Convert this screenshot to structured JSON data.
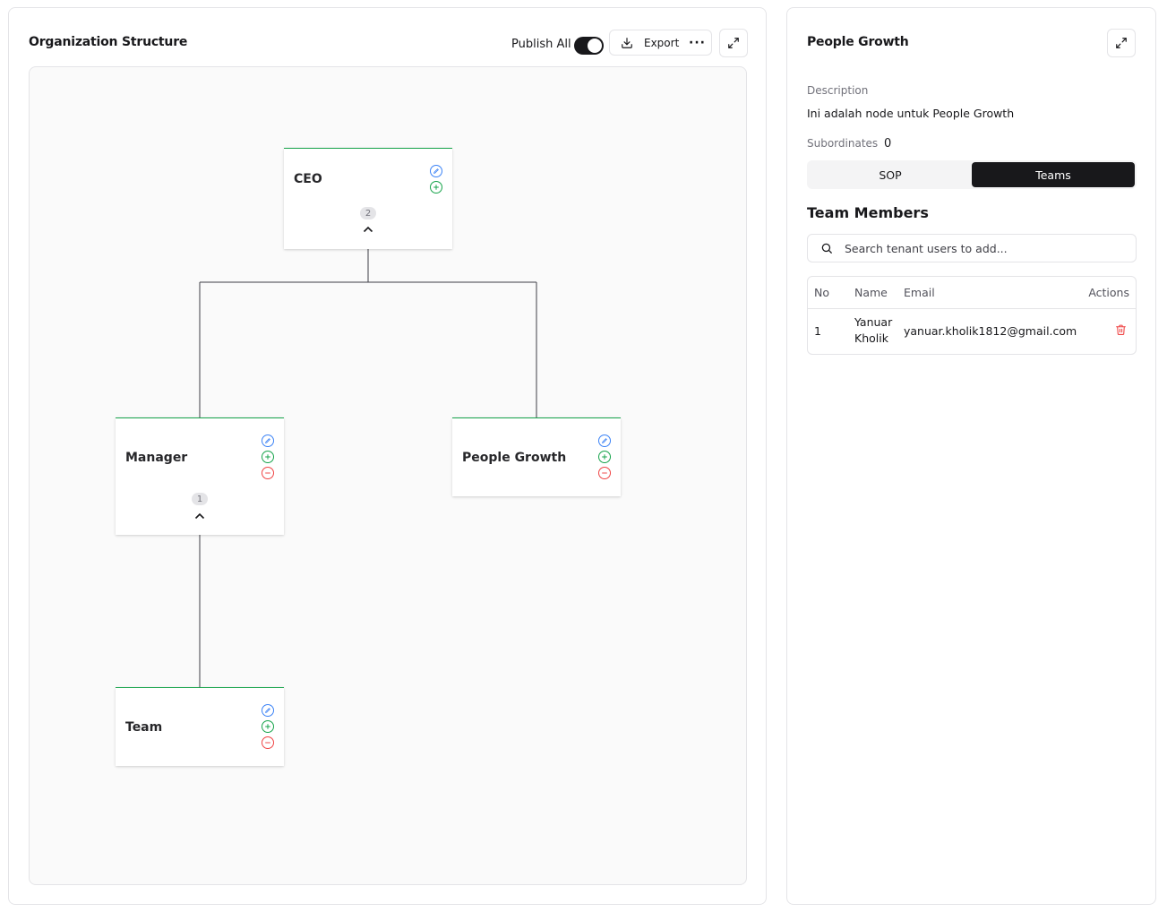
{
  "org_panel": {
    "title": "Organization Structure",
    "publish_label": "Publish All",
    "publish_enabled": true,
    "export_label": "Export",
    "more_label": "···",
    "nodes": {
      "ceo": {
        "title": "CEO",
        "subordinate_count": "2"
      },
      "manager": {
        "title": "Manager",
        "subordinate_count": "1"
      },
      "people_growth": {
        "title": "People Growth"
      },
      "team": {
        "title": "Team"
      }
    }
  },
  "detail_panel": {
    "title": "People Growth",
    "description_label": "Description",
    "description_value": "Ini adalah node untuk People Growth",
    "subordinates_label": "Subordinates",
    "subordinates_value": "0",
    "tabs": [
      {
        "label": "SOP",
        "active": false
      },
      {
        "label": "Teams",
        "active": true
      }
    ],
    "team_heading": "Team Members",
    "search_placeholder": "Search tenant users to add...",
    "table": {
      "headers": {
        "no": "No",
        "name": "Name",
        "email": "Email",
        "actions": "Actions"
      },
      "rows": [
        {
          "no": "1",
          "name_first": "Yanuar",
          "name_last": "Kholik",
          "email": "yanuar.kholik1812@gmail.com"
        }
      ]
    }
  },
  "colors": {
    "accent_dark": "#18181b",
    "node_border": "#16a34a",
    "edit": "#3b82f6",
    "add": "#16a34a",
    "remove": "#ef4444"
  }
}
